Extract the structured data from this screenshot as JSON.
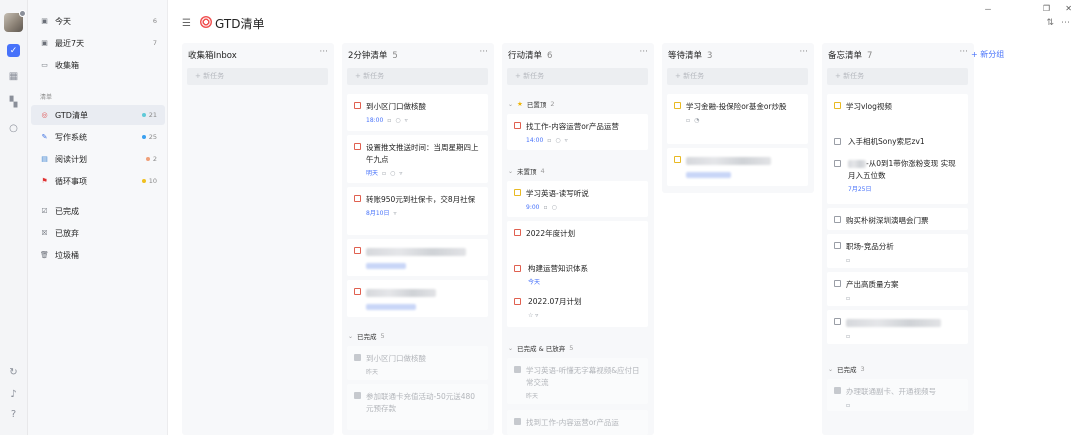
{
  "window": {
    "minimize": "－",
    "restore": "❐",
    "close": "✕"
  },
  "header": {
    "title": "GTD清单"
  },
  "sidebar": {
    "smart": [
      {
        "label": "今天",
        "count": "6"
      },
      {
        "label": "最近7天",
        "count": "7"
      },
      {
        "label": "收集箱",
        "count": ""
      }
    ],
    "section_label": "清单",
    "lists": [
      {
        "label": "GTD清单",
        "count": "21",
        "color": "#5fc9d8"
      },
      {
        "label": "写作系统",
        "count": "25",
        "color": "#3aa0f0"
      },
      {
        "label": "阅读计划",
        "count": "2",
        "color": "#f0a07a"
      },
      {
        "label": "循环事项",
        "count": "10",
        "color": "#f0c020"
      }
    ],
    "others": [
      {
        "label": "已完成"
      },
      {
        "label": "已放弃"
      },
      {
        "label": "垃圾桶"
      }
    ]
  },
  "columns": [
    {
      "title": "收集箱Inbox",
      "count": "",
      "add": "+ 新任务"
    },
    {
      "title": "2分钟清单",
      "count": "5",
      "add": "+ 新任务",
      "cards": [
        {
          "text": "到小区门口做核酸",
          "date": "18:00"
        },
        {
          "text": "设置推文推送时间：当周星期四上午九点",
          "date": "明天"
        },
        {
          "text": "转账950元到社保卡，交8月社保",
          "date": "8月10日"
        }
      ],
      "done_label": "已完成",
      "done_count": "5",
      "done_cards": [
        {
          "text": "到小区门口做核酸",
          "date": "昨天"
        },
        {
          "text": "参加联通卡充值活动-50元送480元预存款",
          "date": ""
        }
      ]
    },
    {
      "title": "行动清单",
      "count": "6",
      "add": "+ 新任务",
      "pinned_label": "已置顶",
      "pinned_count": "2",
      "pinned": [
        {
          "text": "找工作-内容运营or产品运营",
          "date": "14:00"
        }
      ],
      "unpinned_label": "未置顶",
      "unpinned_count": "4",
      "cards": [
        {
          "text": "学习英语-读写听说",
          "date": "9:00"
        },
        {
          "text": "2022年度计划",
          "date": ""
        }
      ],
      "subs": [
        {
          "text": "构建运营知识体系",
          "date": "今天"
        },
        {
          "text": "2022.07月计划",
          "date": ""
        }
      ],
      "done_label": "已完成 & 已放弃",
      "done_count": "5",
      "done_cards": [
        {
          "text": "学习英语-听懂无字幕视频&应付日常交流",
          "date": "昨天"
        },
        {
          "text": "找到工作-内容运营or产品运",
          "date": ""
        }
      ]
    },
    {
      "title": "等待清单",
      "count": "3",
      "add": "+ 新任务",
      "cards": [
        {
          "text": "学习金融-投保险or基金or炒股",
          "date": ""
        }
      ]
    },
    {
      "title": "备忘清单",
      "count": "7",
      "add": "+ 新任务",
      "parent": {
        "text": "学习vlog视频"
      },
      "subs": [
        {
          "text": "入手相机Sony索尼zv1",
          "date": ""
        },
        {
          "text": "-从0到1带你涨粉变现 实现月入五位数",
          "date": "7月25日"
        }
      ],
      "cards": [
        {
          "text": "购买朴树深圳演唱会门票"
        },
        {
          "text": "职场-竞品分析"
        },
        {
          "text": "产出高质量方案"
        }
      ],
      "done_label": "已完成",
      "done_count": "3",
      "done_cards": [
        {
          "text": "办理联通副卡、开通视频号"
        }
      ]
    }
  ],
  "new_group": "+ 新分组"
}
